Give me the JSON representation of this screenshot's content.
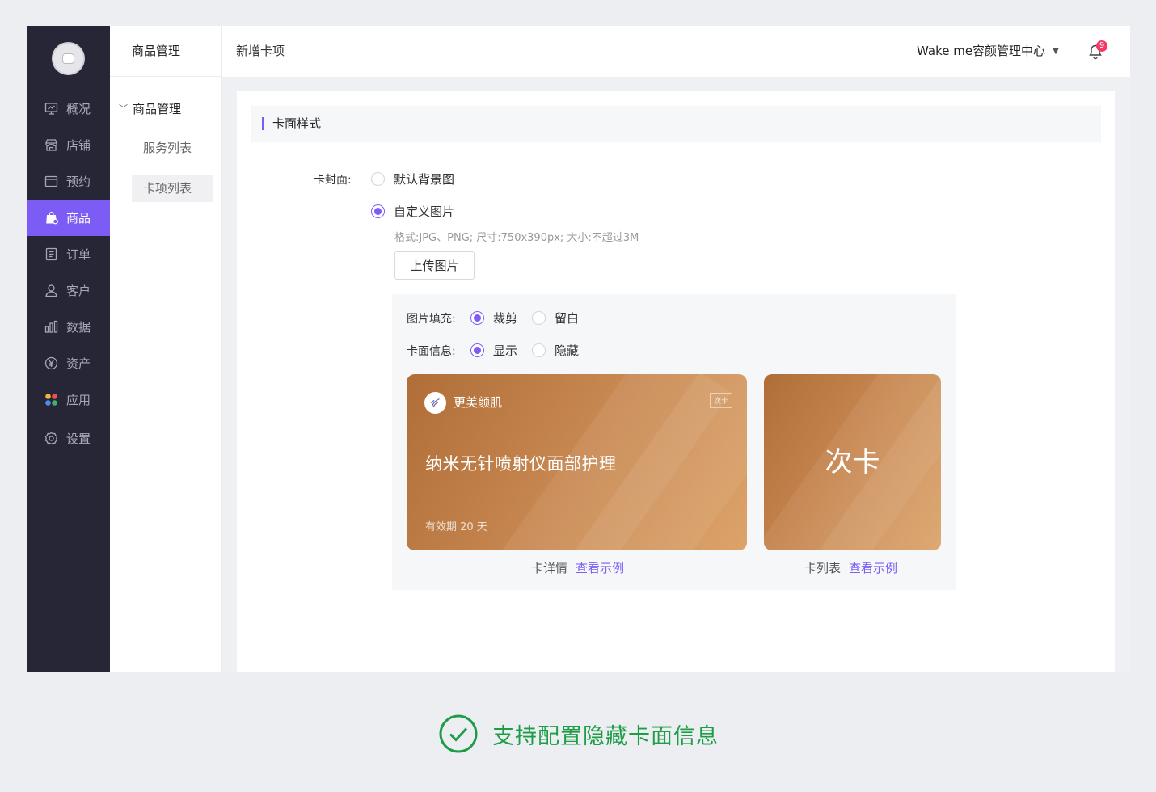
{
  "sidebar": {
    "items": [
      {
        "label": "概况",
        "icon": "monitor-icon"
      },
      {
        "label": "店铺",
        "icon": "store-icon"
      },
      {
        "label": "预约",
        "icon": "calendar-icon"
      },
      {
        "label": "商品",
        "icon": "shopping-bag-icon",
        "active": true
      },
      {
        "label": "订单",
        "icon": "document-icon"
      },
      {
        "label": "客户",
        "icon": "user-icon"
      },
      {
        "label": "数据",
        "icon": "bar-chart-icon"
      },
      {
        "label": "资产",
        "icon": "yen-coin-icon"
      },
      {
        "label": "应用",
        "icon": "apps-grid-icon"
      },
      {
        "label": "设置",
        "icon": "gear-icon"
      }
    ]
  },
  "subnav": {
    "title": "商品管理",
    "group": "商品管理",
    "items": [
      {
        "label": "服务列表"
      },
      {
        "label": "卡项列表",
        "active": true
      }
    ]
  },
  "header": {
    "title": "新增卡项",
    "org": "Wake me容颜管理中心",
    "notification_count": "9"
  },
  "section": {
    "title": "卡面样式"
  },
  "cover": {
    "label": "卡封面:",
    "options": [
      "默认背景图",
      "自定义图片"
    ],
    "selected": "自定义图片",
    "hint": "格式:JPG、PNG; 尺寸:750x390px; 大小:不超过3M",
    "upload_label": "上传图片"
  },
  "fill": {
    "label": "图片填充:",
    "options": [
      "裁剪",
      "留白"
    ],
    "selected": "裁剪"
  },
  "info": {
    "label": "卡面信息:",
    "options": [
      "显示",
      "隐藏"
    ],
    "selected": "显示"
  },
  "card_detail": {
    "brand": "更美颜肌",
    "tag": "次卡",
    "service": "纳米无针喷射仪面部护理",
    "validity": "有效期 20 天",
    "caption": "卡详情",
    "link": "查看示例"
  },
  "card_list": {
    "title": "次卡",
    "caption": "卡列表",
    "link": "查看示例"
  },
  "footer_note": "支持配置隐藏卡面信息",
  "colors": {
    "accent": "#7c5cf5",
    "sidebar_bg": "#262637",
    "card_gradient_start": "#b06d38",
    "card_gradient_end": "#dca36a",
    "success": "#1e9d47",
    "badge": "#f23a67"
  }
}
